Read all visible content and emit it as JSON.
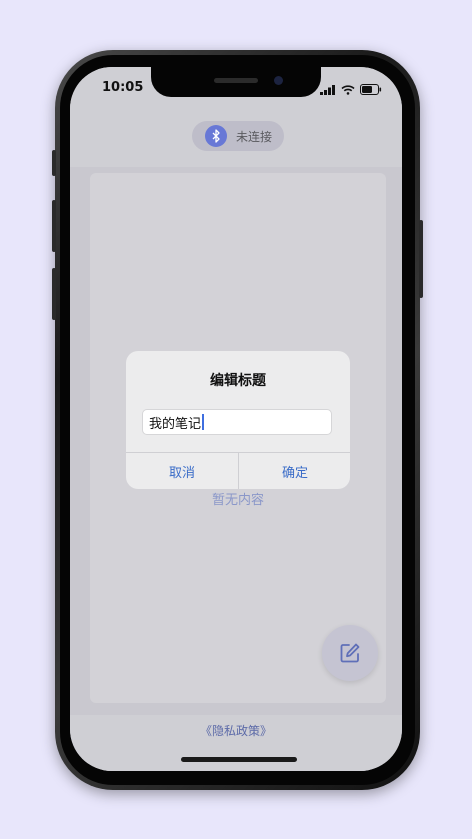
{
  "status_bar": {
    "time": "10:05"
  },
  "connection": {
    "icon": "bluetooth-icon",
    "label": "未连接"
  },
  "content": {
    "empty_text": "暂无内容"
  },
  "fab": {
    "icon": "edit-icon"
  },
  "footer": {
    "privacy_link": "《隐私政策》"
  },
  "dialog": {
    "title": "编辑标题",
    "input_value": "我的笔记",
    "cancel_label": "取消",
    "confirm_label": "确定"
  },
  "colors": {
    "accent": "#3a6cc8",
    "bluetooth_badge": "#6878d6",
    "background": "#e8e6fb"
  }
}
